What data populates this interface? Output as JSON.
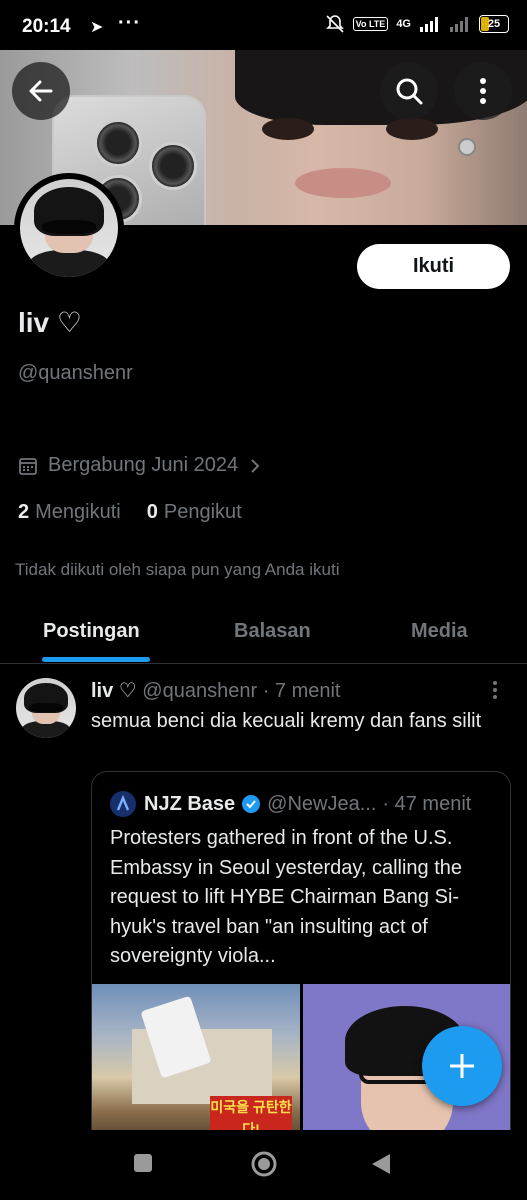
{
  "status_bar": {
    "time": "20:14",
    "volte": "Vo LTE",
    "network": "4G",
    "battery": "25"
  },
  "profile": {
    "name": "liv ♡",
    "handle": "@quanshenr",
    "follow_label": "Ikuti",
    "joined": "Bergabung Juni 2024",
    "following_count": "2",
    "following_label": "Mengikuti",
    "followers_count": "0",
    "followers_label": "Pengikut",
    "not_followed_note": "Tidak diikuti oleh siapa pun yang Anda ikuti"
  },
  "tabs": [
    {
      "label": "Postingan",
      "active": true
    },
    {
      "label": "Balasan",
      "active": false
    },
    {
      "label": "Media",
      "active": false
    }
  ],
  "post": {
    "name": "liv ♡",
    "handle": "@quanshenr",
    "time": "· 7 menit",
    "text": "semua benci dia kecuali kremy dan fans silit",
    "quote": {
      "name": "NJZ Base",
      "handle": "@NewJea...",
      "time": "· 47 menit",
      "text": "Protesters gathered in front of the U.S. Embassy in Seoul yesterday, calling the request to lift HYBE Chairman Bang Si-hyuk's travel ban \"an insulting act of sovereignty viola...",
      "image1_banner": "미국을 규탄한다!"
    }
  },
  "colors": {
    "accent": "#1d9bf0",
    "background": "#000000",
    "muted_text": "#71767b"
  }
}
